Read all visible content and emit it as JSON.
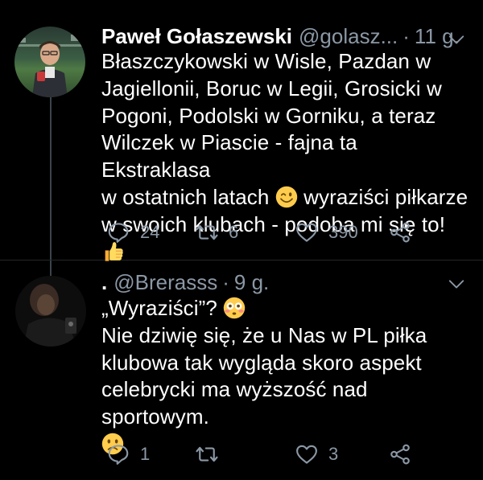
{
  "tweets": [
    {
      "display_name": "Paweł Gołaszewski",
      "handle": "@golasz...",
      "separator": "·",
      "time": "11 g.",
      "text_lines": [
        "Błaszczykowski w Wisle, Pazdan w",
        "Jagiellonii, Boruc w Legii, Grosicki w",
        "Pogoni, Podolski w Gorniku, a teraz",
        "Wilczek w Piascie - fajna ta Ekstraklasa",
        "w ostatnich latach",
        "wyraziści piłkarze",
        "w swoich klubach - podoba mi się to!"
      ],
      "emojis": [
        "winking-face-emoji",
        "thumbs-up-emoji"
      ],
      "reply_count": "24",
      "retweet_count": "6",
      "like_count": "390"
    },
    {
      "display_name": ".",
      "handle": "@Brerasss",
      "separator": "·",
      "time": "9 g.",
      "text_lines": [
        "„Wyraziści”?",
        "Nie dziwię się, że u Nas w PL piłka",
        "klubowa tak wygląda skoro aspekt",
        "celebrycki ma wyższość nad sportowym."
      ],
      "emojis": [
        "flushed-face-emoji",
        "slightly-frowning-face-emoji"
      ],
      "reply_count": "1",
      "retweet_count": "",
      "like_count": "3"
    }
  ],
  "colors": {
    "background": "#000000",
    "text": "#ffffff",
    "secondary": "#8b98a5",
    "divider": "#22262a",
    "thread_line": "#3d4349",
    "emoji_yellow": "#ffcc4d"
  }
}
